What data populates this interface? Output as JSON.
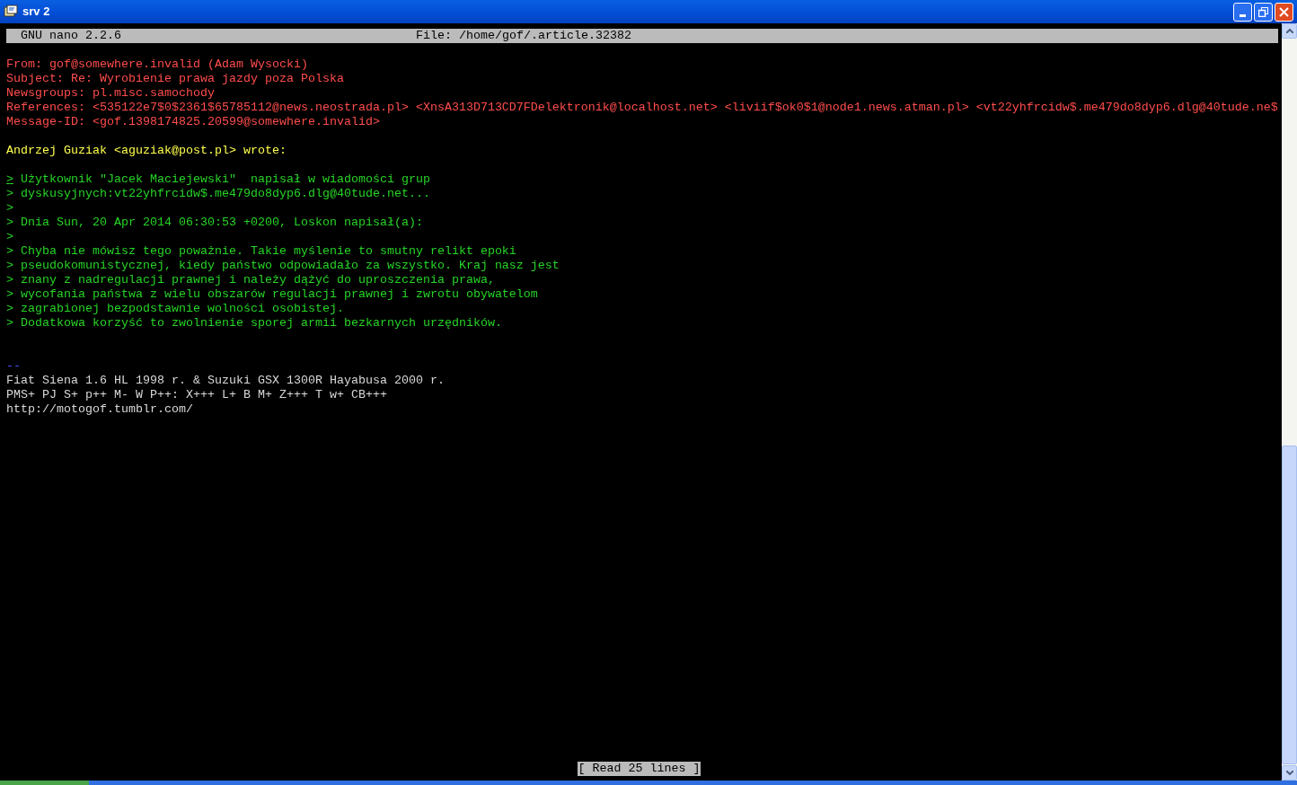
{
  "window": {
    "title": "srv 2"
  },
  "nano_bar": {
    "version": "GNU nano 2.2.6",
    "file": "File: /home/gof/.article.32382"
  },
  "lines": [
    {
      "kind": "blank"
    },
    {
      "kind": "header",
      "text": "From: gof@somewhere.invalid (Adam Wysocki)",
      "cursor": false
    },
    {
      "kind": "header",
      "text": "Subject: Re: Wyrobienie prawa jazdy poza Polska",
      "cursor": false
    },
    {
      "kind": "header",
      "text": "Newsgroups: pl.misc.samochody",
      "cursor": false
    },
    {
      "kind": "header",
      "text": "References: <535122e7$0$2361$65785112@news.neostrada.pl> <XnsA313D713CD7FDelektronik@localhost.net> <liviif$ok0$1@node1.news.atman.pl> <vt22yhfrcidw$.me479do8dyp6.dlg@40tude.ne$",
      "cursor": false
    },
    {
      "kind": "header",
      "text": "Message-ID: <gof.1398174825.20599@somewhere.invalid>",
      "cursor": false
    },
    {
      "kind": "blank"
    },
    {
      "kind": "attribution",
      "text": "Andrzej Guziak <aguziak@post.pl> wrote:",
      "cursor": false
    },
    {
      "kind": "blank"
    },
    {
      "kind": "quote",
      "text": "> Użytkownik \"Jacek Maciejewski\"  napisał w wiadomości grup",
      "cursor": true
    },
    {
      "kind": "quote",
      "text": "> dyskusyjnych:vt22yhfrcidw$.me479do8dyp6.dlg@40tude.net...",
      "cursor": false
    },
    {
      "kind": "quote",
      "text": ">",
      "cursor": false
    },
    {
      "kind": "quote",
      "text": "> Dnia Sun, 20 Apr 2014 06:30:53 +0200, Loskon napisał(a):",
      "cursor": false
    },
    {
      "kind": "quote",
      "text": ">",
      "cursor": false
    },
    {
      "kind": "quote",
      "text": "> Chyba nie mówisz tego poważnie. Takie myślenie to smutny relikt epoki",
      "cursor": false
    },
    {
      "kind": "quote",
      "text": "> pseudokomunistycznej, kiedy państwo odpowiadało za wszystko. Kraj nasz jest",
      "cursor": false
    },
    {
      "kind": "quote",
      "text": "> znany z nadregulacji prawnej i należy dążyć do uproszczenia prawa,",
      "cursor": false
    },
    {
      "kind": "quote",
      "text": "> wycofania państwa z wielu obszarów regulacji prawnej i zwrotu obywatelom",
      "cursor": false
    },
    {
      "kind": "quote",
      "text": "> zagrabionej bezpodstawnie wolności osobistej.",
      "cursor": false
    },
    {
      "kind": "quote",
      "text": "> Dodatkowa korzyść to zwolnienie sporej armii bezkarnych urzędników.",
      "cursor": false
    },
    {
      "kind": "blank"
    },
    {
      "kind": "blank"
    },
    {
      "kind": "signature_separator",
      "text": "--",
      "cursor": false
    },
    {
      "kind": "plain",
      "text": "Fiat Siena 1.6 HL 1998 r. & Suzuki GSX 1300R Hayabusa 2000 r.",
      "cursor": false
    },
    {
      "kind": "plain",
      "text": "PMS+ PJ S+ p++ M- W P++: X+++ L+ B M+ Z+++ T w+ CB+++",
      "cursor": false
    },
    {
      "kind": "plain",
      "text": "http://motogof.tumblr.com/",
      "cursor": false
    }
  ],
  "status": "[ Read 25 lines ]"
}
